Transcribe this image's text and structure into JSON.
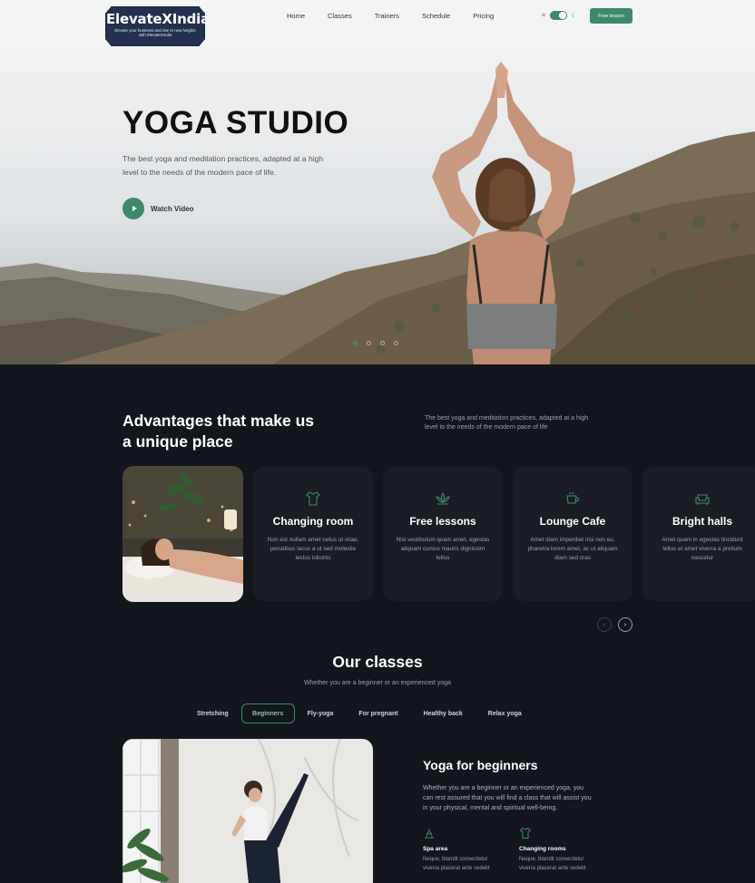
{
  "brand": {
    "name": "ElevateXIndia",
    "tagline": "Elevate your business and rise to new heights with ElevateXIndia"
  },
  "nav": {
    "items": [
      {
        "label": "Home"
      },
      {
        "label": "Classes"
      },
      {
        "label": "Trainers"
      },
      {
        "label": "Schedule"
      },
      {
        "label": "Pricing"
      }
    ],
    "cta": "Free lesson",
    "theme_toggle": {
      "state": "dark",
      "icons": [
        "sun-icon",
        "moon-icon"
      ]
    }
  },
  "hero": {
    "title": "YOGA STUDIO",
    "subtitle": "The best yoga and meditation practices, adapted at a high level to the needs of the modern pace of life.",
    "watch_label": "Watch Video",
    "slides": 4,
    "active_slide": 1
  },
  "advantages": {
    "title": "Advantages that make us a unique place",
    "description": "The best yoga and meditation practices, adapted at a high level to the needs of the modern pace of life",
    "cards": [
      {
        "icon": "shirt-icon",
        "title": "Changing room",
        "text": "Non est nullam amet netus ut vitae, penatibus lacus a ut sed molestie lectus lobortis"
      },
      {
        "icon": "lotus-icon",
        "title": "Free lessons",
        "text": "Nisi vestibulum quam amet, egestas aliquam cursus mauris dignissim tellus"
      },
      {
        "icon": "cup-icon",
        "title": "Lounge Cafe",
        "text": "Amet diam imperdiet nisi non eu, pharetra lorem amet, ac ut aliquam diam sed cras"
      },
      {
        "icon": "sofa-icon",
        "title": "Bright halls",
        "text": "Amet quam in egestas tincidunt tellus et amet viverra a pretium nascetur"
      }
    ]
  },
  "classes": {
    "title": "Our classes",
    "subtitle": "Whether you are a beginner or an experienced yoga",
    "tabs": [
      {
        "label": "Stretching"
      },
      {
        "label": "Beginners"
      },
      {
        "label": "Fly-yoga"
      },
      {
        "label": "For pregnant"
      },
      {
        "label": "Healthy back"
      },
      {
        "label": "Relax yoga"
      }
    ],
    "active_tab": "Beginners",
    "detail": {
      "title": "Yoga for beginners",
      "text": "Whether you are a beginner or an experienced yoga, you can rest assured that you will find a class that will assist you in your physical, mental and spiritual well-being.",
      "features": [
        {
          "icon": "spa-icon",
          "title": "Spa area",
          "text": "Neque, blandit consectetur viverra placerat ante sedelit"
        },
        {
          "icon": "shirt-icon",
          "title": "Changing rooms",
          "text": "Neque, blandit consectetur viverra placerat ante sedelit"
        }
      ]
    }
  },
  "colors": {
    "accent": "#3d8a6b",
    "dark_bg": "#13161c",
    "card_bg": "#1a1d23"
  }
}
